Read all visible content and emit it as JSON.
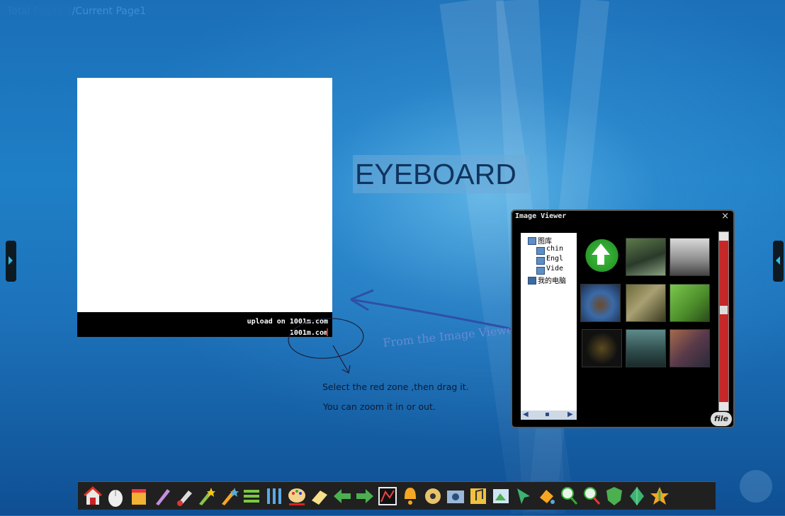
{
  "page_status": {
    "prefix": "Total",
    "middle": "Pages 1",
    "suffix": "/Current Page1"
  },
  "image_box": {
    "caption_1": "upload on 1001m.com",
    "caption_2": "1001m.com"
  },
  "eyeboard_label": "EYEBOARD",
  "annotations": {
    "from_viewer": "From the Image Viewer",
    "line_1": "Select the red zone ,then drag it.",
    "line_2": "You can  zoom it in or out."
  },
  "image_viewer": {
    "title": "Image Viewer",
    "close_glyph": "×",
    "tree_items": [
      "图库",
      "chin",
      "Engl",
      "Vide",
      "我的电脑"
    ],
    "file_button": "file"
  },
  "toolbar": {
    "icons": [
      "home-icon",
      "mouse-icon",
      "note-icon",
      "pen-icon",
      "brush-icon",
      "magic-pen-icon",
      "star-pen-icon",
      "lines-icon",
      "columns-icon",
      "palette-icon",
      "eraser-icon",
      "arrow-left-icon",
      "arrow-right-icon",
      "image-box-icon",
      "bell-icon",
      "film-icon",
      "camera-icon",
      "music-icon",
      "screen-shot-icon",
      "cursor-icon",
      "fill-icon",
      "zoom-in-icon",
      "zoom-out-icon",
      "shield-icon",
      "crystal-icon",
      "star-icon"
    ]
  }
}
